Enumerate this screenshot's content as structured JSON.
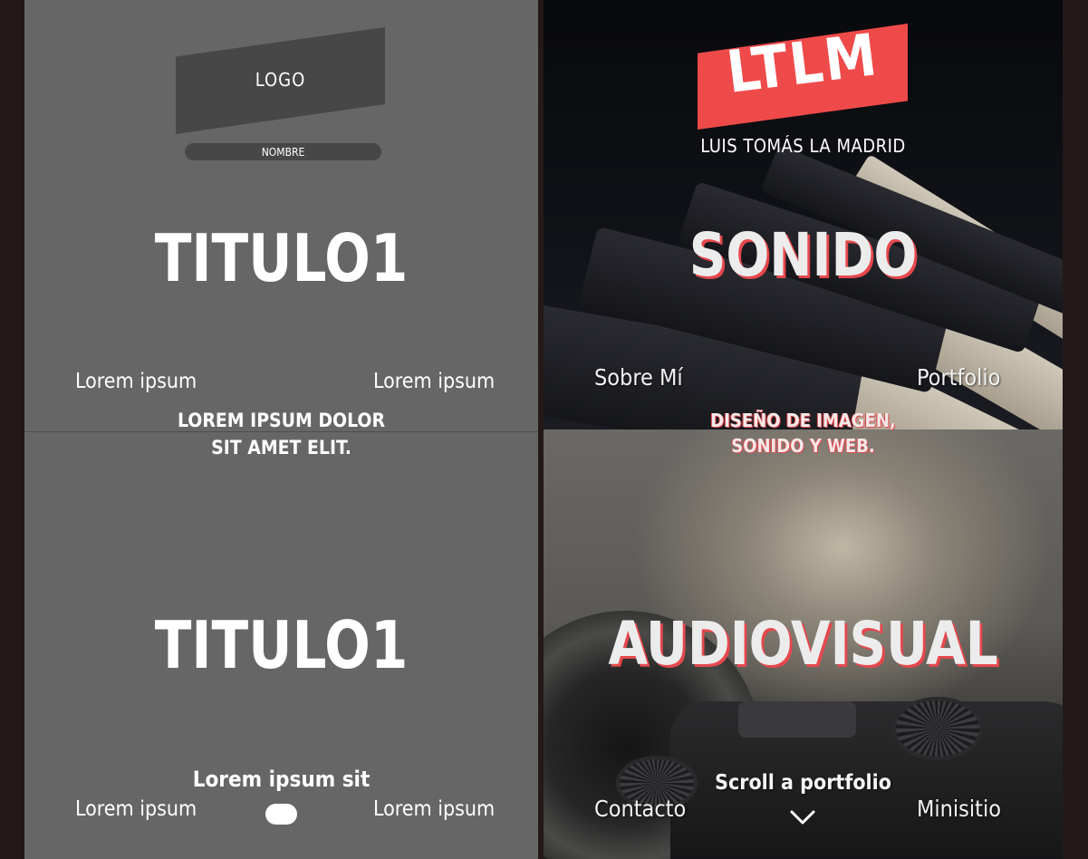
{
  "wireframe": {
    "logo_label": "LOGO",
    "name_label": "NOMBRE",
    "title_top": "TITULO1",
    "title_bottom": "TITULO1",
    "links_top": [
      "Lorem ipsum",
      "Lorem ipsum"
    ],
    "subtitle_lines": [
      "LOREM IPSUM DOLOR",
      "SIT AMET ELIT."
    ],
    "bottom_text": "Lorem ipsum sit",
    "links_bottom": [
      "Lorem ipsum",
      "Lorem ipsum"
    ]
  },
  "design": {
    "logo_text": "LTLM",
    "brand_name": "LUIS TOMÁS LA MADRID",
    "title_top": "SONIDO",
    "title_bottom": "AUDIOVISUAL",
    "nav_top": [
      "Sobre Mí",
      "Portfolio"
    ],
    "tagline_lines": [
      "DISEÑO DE IMAGEN,",
      "SONIDO Y WEB."
    ],
    "scroll_label": "Scroll a portfolio",
    "nav_bottom": [
      "Contacto",
      "Minisitio"
    ],
    "accent_color": "#ef4a4a",
    "icons": [
      "chevron-down-icon"
    ]
  }
}
